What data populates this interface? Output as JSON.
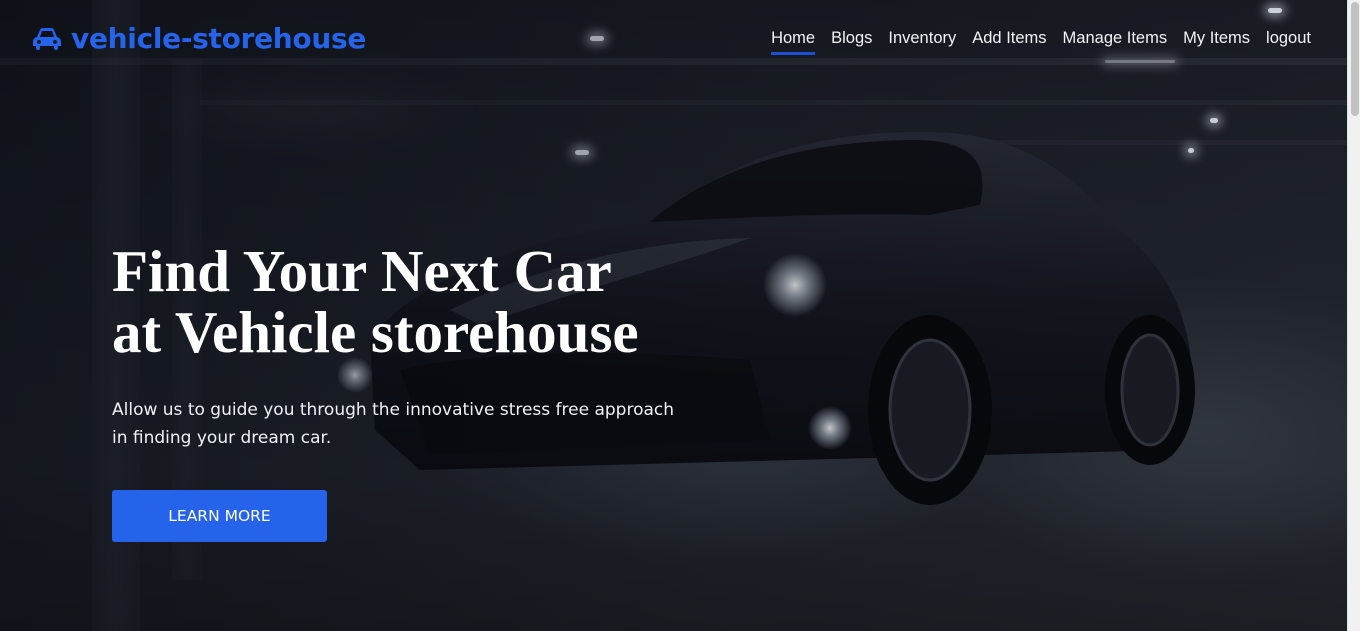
{
  "brand": {
    "name": "vehicle-storehouse",
    "icon": "car-icon",
    "color": "#2563eb"
  },
  "nav": {
    "links": [
      {
        "label": "Home",
        "active": true
      },
      {
        "label": "Blogs",
        "active": false
      },
      {
        "label": "Inventory",
        "active": false
      },
      {
        "label": "Add Items",
        "active": false
      },
      {
        "label": "Manage Items",
        "active": false
      },
      {
        "label": "My Items",
        "active": false
      },
      {
        "label": "logout",
        "active": false
      }
    ]
  },
  "hero": {
    "title_line1": "Find Your Next Car",
    "title_line2": "at Vehicle storehouse",
    "subtitle": "Allow us to guide you through the innovative stress free approach in finding your dream car.",
    "cta_label": "LEARN MORE",
    "accent": "#2563eb"
  }
}
